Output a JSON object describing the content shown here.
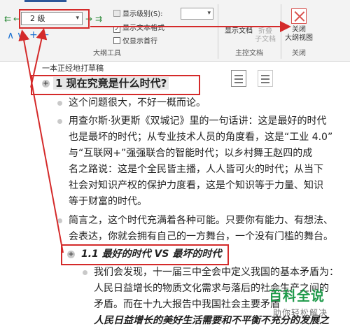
{
  "ribbon": {
    "level_select": {
      "value": "2 级"
    },
    "show_level_label": "显示级别(S):",
    "show_text_format_label": "显示文本格式",
    "first_line_only_label": "仅显示首行",
    "outline_tools_label": "大纲工具",
    "show_doc_label": "显示文档",
    "collapse_subdoc_label_1": "折叠",
    "collapse_subdoc_label_2": "子文档",
    "master_doc_group_label": "主控文档",
    "close_view_label_1": "关闭",
    "close_view_label_2": "大纲视图",
    "close_group_label": "关闭",
    "show_text_format_checked": true,
    "first_line_only_checked": false
  },
  "document": {
    "top_line": "一本正经地打草稿",
    "h1": "1 现在究竟是什么时代?",
    "p1": "这个问题很大，不好一概而论。",
    "p2_lines": [
      "用查尔斯·狄更斯《双城记》里的一句话讲：这是最好的时代",
      "也是最坏的时代；从专业技术人员的角度看，这是“工业 4.0”",
      "与“互联网+”强强联合的智能时代；以乡村舞王赵四的成",
      "名之路说：这是个全民皆主播，人人皆可火的时代；从当下",
      "社会对知识产权的保护力度看，这是个知识等于力量、知识",
      "等于财富的时代。"
    ],
    "p3_lines": [
      "简言之，这个时代充满着各种可能。只要你有能力、有想法、",
      "会表达，你就会拥有自己的一方舞台，一个没有门槛的舞台。"
    ],
    "h2": "1.1 最好的时代 VS 最坏的时代",
    "p4_lines": [
      "我们会发现，十一届三中全会中定义我国的基本矛盾为：",
      "人民日益增长的物质文化需求与落后的社会生产之间的",
      "矛盾。而在十九大报告中我国社会主要矛盾",
      "人民日益增长的美好生活需要和不平衡不充分的发展之"
    ]
  },
  "watermark": {
    "title": "百科全说",
    "subtitle": "助你轻松解决"
  },
  "colors": {
    "annotation_red": "#d42a2a",
    "watermark_green": "#1e9a4a",
    "promote_arrow_green": "#2e8b3a",
    "move_blue": "#1a6fd1"
  },
  "icons": {
    "promote_to_heading1": "double-left-arrow-icon",
    "promote": "left-arrow-icon",
    "demote": "right-arrow-icon",
    "demote_to_body": "double-right-arrow-icon",
    "move_up": "up-arrow-icon",
    "move_down": "down-arrow-icon",
    "expand": "plus-icon",
    "collapse": "minus-icon",
    "close_outline": "close-x-icon"
  }
}
